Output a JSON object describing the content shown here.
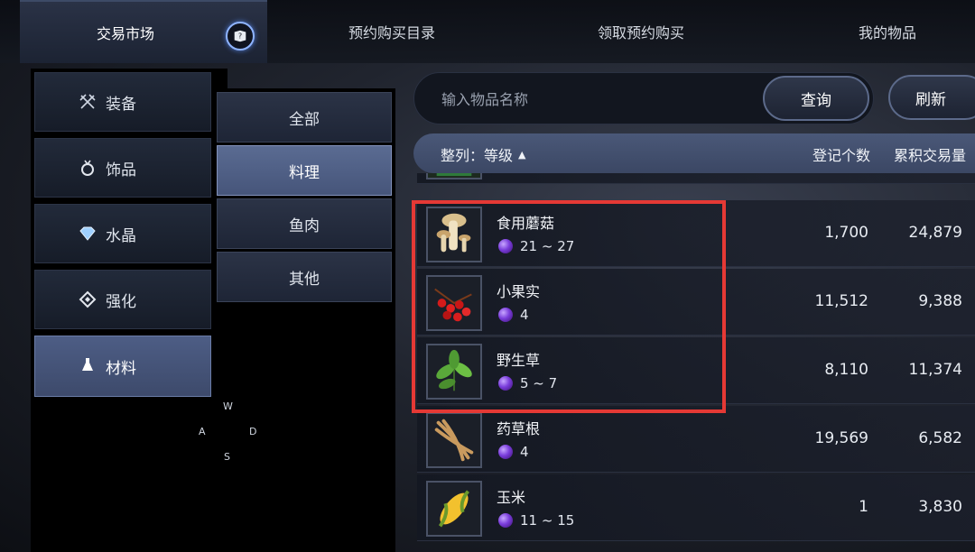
{
  "tabs": [
    {
      "label": "交易市场"
    },
    {
      "label": "预约购买目录"
    },
    {
      "label": "领取预约购买"
    },
    {
      "label": "我的物品"
    }
  ],
  "categories": [
    {
      "label": "装备",
      "icon": "crossed-swords-icon"
    },
    {
      "label": "饰品",
      "icon": "ring-icon"
    },
    {
      "label": "水晶",
      "icon": "diamond-icon"
    },
    {
      "label": "强化",
      "icon": "enhance-icon"
    },
    {
      "label": "材料",
      "icon": "potion-icon"
    }
  ],
  "subcategories": [
    {
      "label": "全部"
    },
    {
      "label": "料理"
    },
    {
      "label": "鱼肉"
    },
    {
      "label": "其他"
    }
  ],
  "wasd": {
    "w": "W",
    "a": "A",
    "s": "S",
    "d": "D"
  },
  "search": {
    "placeholder": "输入物品名称",
    "query_label": "查询",
    "refresh_label": "刷新"
  },
  "table": {
    "sort_label": "整列：等级",
    "sort_arrow": "▲",
    "col_count": "登记个数",
    "col_volume": "累积交易量"
  },
  "items": [
    {
      "name": "食用蘑菇",
      "level": "21 ~ 27",
      "count": "1,700",
      "volume": "24,879",
      "icon": "mushroom-icon"
    },
    {
      "name": "小果实",
      "level": "4",
      "count": "11,512",
      "volume": "9,388",
      "icon": "red-berries-icon"
    },
    {
      "name": "野生草",
      "level": "5 ~ 7",
      "count": "8,110",
      "volume": "11,374",
      "icon": "wild-herb-icon"
    },
    {
      "name": "药草根",
      "level": "4",
      "count": "19,569",
      "volume": "6,582",
      "icon": "herb-root-icon"
    },
    {
      "name": "玉米",
      "level": "11 ~ 15",
      "count": "1",
      "volume": "3,830",
      "icon": "corn-icon"
    }
  ],
  "colors": {
    "highlight": "#e53935",
    "accent": "#5c6a8a",
    "active_category": "#4d5d85"
  }
}
